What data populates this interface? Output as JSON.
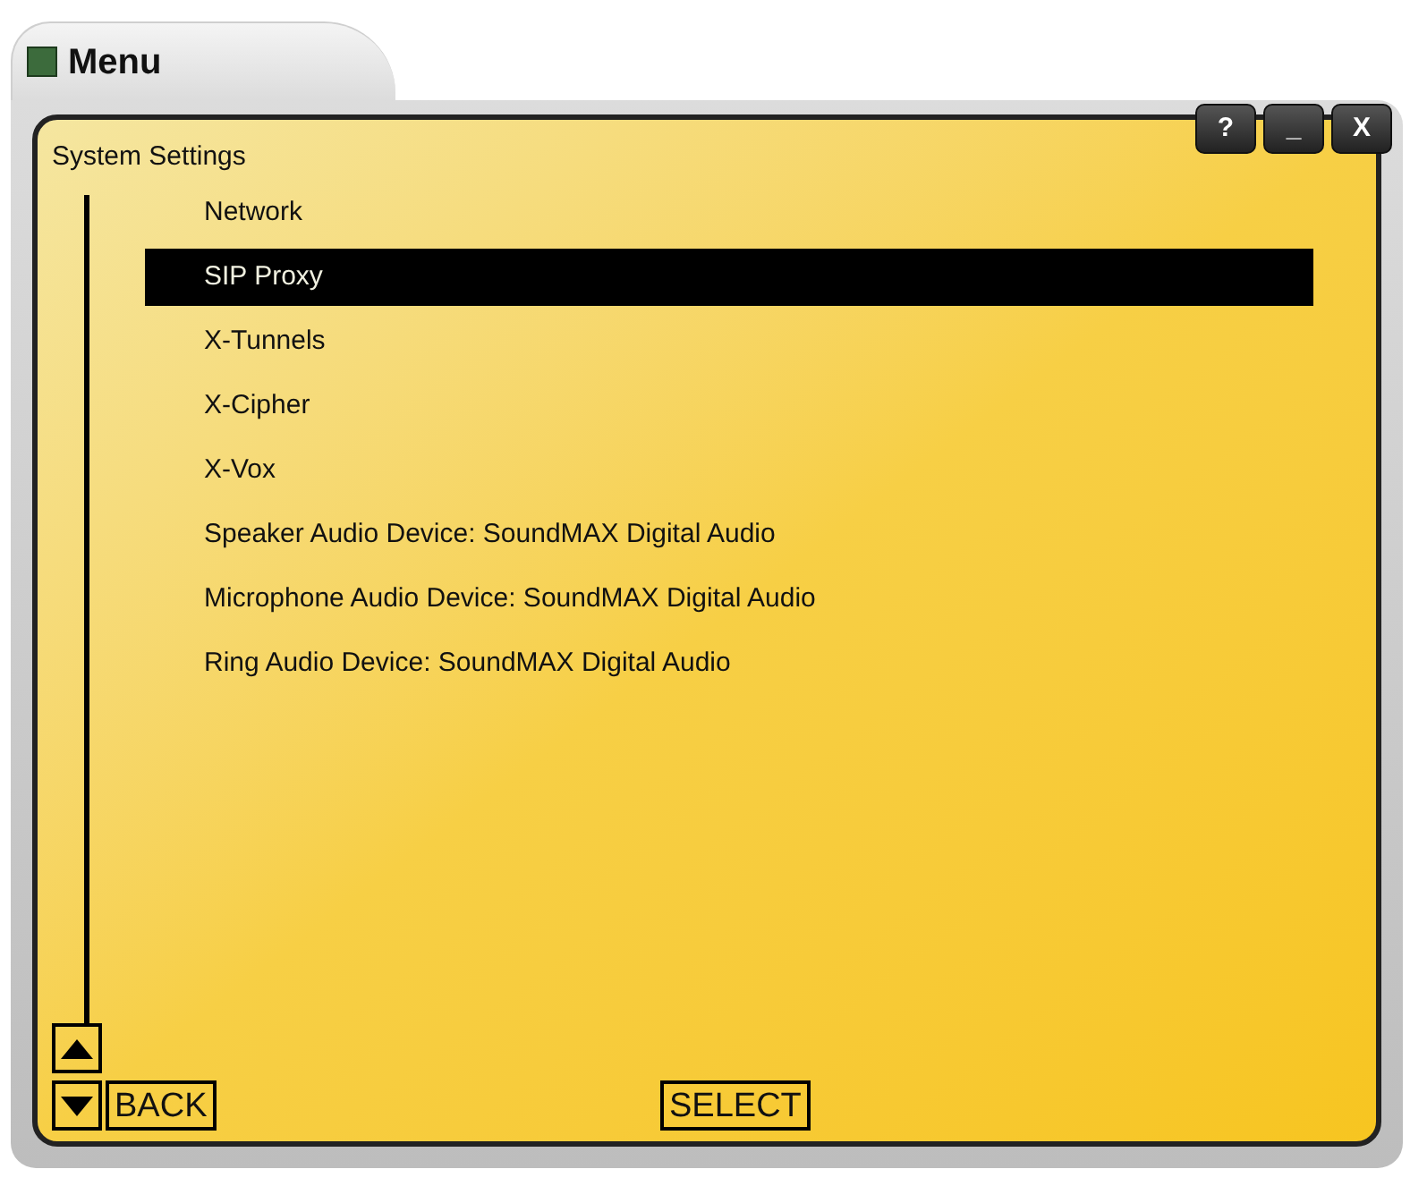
{
  "window": {
    "title": "Menu"
  },
  "panel": {
    "title": "System Settings"
  },
  "title_buttons": [
    {
      "label": "?"
    },
    {
      "label": "_"
    },
    {
      "label": "X"
    }
  ],
  "items": [
    {
      "label": "Network",
      "selected": false
    },
    {
      "label": "SIP Proxy",
      "selected": true
    },
    {
      "label": "X-Tunnels",
      "selected": false
    },
    {
      "label": "X-Cipher",
      "selected": false
    },
    {
      "label": "X-Vox",
      "selected": false
    },
    {
      "label": "Speaker Audio Device: SoundMAX Digital Audio",
      "selected": false
    },
    {
      "label": "Microphone Audio Device: SoundMAX Digital Audio",
      "selected": false
    },
    {
      "label": "Ring Audio Device: SoundMAX Digital Audio",
      "selected": false
    }
  ],
  "footer": {
    "back": "BACK",
    "select": "SELECT"
  }
}
